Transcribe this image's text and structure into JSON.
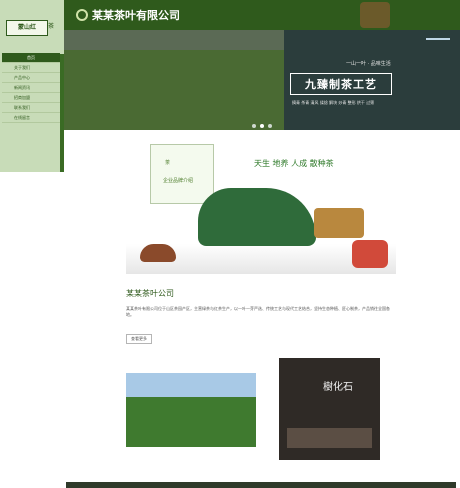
{
  "header": {
    "brand": "某某茶叶有限公司"
  },
  "sidebar": {
    "logo": "蒙山红",
    "logo_tag": "茶",
    "items": [
      {
        "label": "首页"
      },
      {
        "label": "关于我们"
      },
      {
        "label": "产品中心"
      },
      {
        "label": "新闻资讯"
      },
      {
        "label": "招商加盟"
      },
      {
        "label": "联系我们"
      },
      {
        "label": "在线留言"
      }
    ]
  },
  "banner": {
    "slogan": "一山一叶 · 品味生活",
    "title": "九臻制茶工艺",
    "keywords": "摘青 杀青 清风 揉捻 解块 炒青 整形 烘干 过筛",
    "dots": 3,
    "active_dot": 1
  },
  "hero": {
    "badge": "茶",
    "caption": "企业品牌介绍",
    "headline": "天生 地养 人成 散种茶"
  },
  "about": {
    "title": "某某茶叶公司",
    "text": "某某茶叶有限公司位于山区茶园产区，主营绿茶与红茶生产，以一叶一芽严选、传统工艺与现代工艺结合，坚持生态种植、匠心制茶，产品销往全国各地。",
    "more": "查看更多"
  },
  "photos": {
    "right_title": "樹化石"
  },
  "colors": {
    "primary": "#2f5a1c",
    "sidebar_bg": "#c8dcb8",
    "accent_text": "#2f7a2a"
  }
}
